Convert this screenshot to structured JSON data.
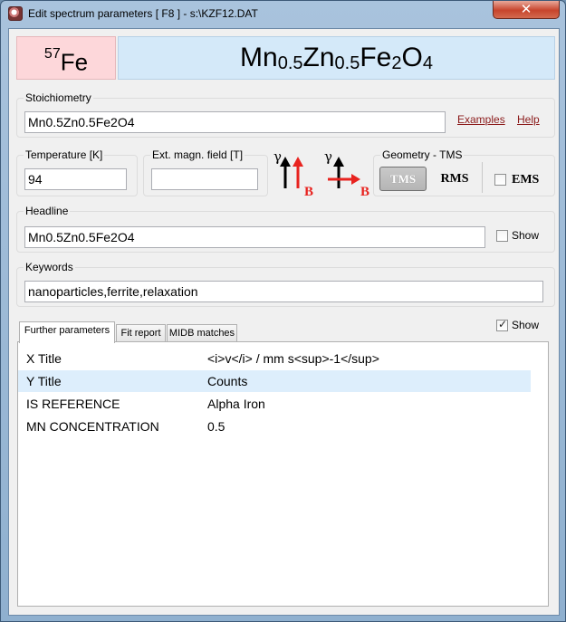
{
  "window": {
    "title": "Edit spectrum parameters [ F8 ] - s:\\KZF12.DAT",
    "close_glyph": "✕"
  },
  "header": {
    "isotope_mass": "57",
    "isotope_symbol": "Fe",
    "formula_parts": [
      {
        "text": "Mn",
        "sub": "0.5"
      },
      {
        "text": "Zn",
        "sub": "0.5"
      },
      {
        "text": "Fe",
        "sub": "2"
      },
      {
        "text": "O",
        "sub": "4"
      }
    ]
  },
  "stoichiometry": {
    "label": "Stoichiometry",
    "value": "Mn0.5Zn0.5Fe2O4",
    "examples_link": "Examples",
    "help_link": "Help"
  },
  "temperature": {
    "label": "Temperature [K]",
    "value": "94"
  },
  "magnetic_field": {
    "label": "Ext. magn. field  [T]",
    "value": ""
  },
  "field_icons": {
    "gamma_symbol": "γ",
    "b_symbol": "B",
    "colors": {
      "beam": "#000000",
      "field": "#e8231f"
    }
  },
  "geometry": {
    "label": "Geometry - TMS",
    "tms_label": "TMS",
    "rms_label": "RMS",
    "ems_label": "EMS",
    "ems_checked": false
  },
  "headline": {
    "label": "Headline",
    "value": "Mn0.5Zn0.5Fe2O4",
    "show_label": "Show",
    "show_checked": false
  },
  "keywords": {
    "label": "Keywords",
    "value": "nanoparticles,ferrite,relaxation"
  },
  "tabs": [
    {
      "label": "Further parameters",
      "active": true
    },
    {
      "label": "Fit report",
      "active": false
    },
    {
      "label": "MIDB matches",
      "active": false
    }
  ],
  "tabs_show": {
    "label": "Show",
    "checked": true
  },
  "parameters": [
    {
      "key": "X Title",
      "value": "<i>v</i> / mm s<sup>-1</sup>",
      "selected": false
    },
    {
      "key": "Y Title",
      "value": "Counts",
      "selected": true
    },
    {
      "key": "IS REFERENCE",
      "value": "Alpha Iron",
      "selected": false
    },
    {
      "key": "MN CONCENTRATION",
      "value": "0.5",
      "selected": false
    }
  ]
}
